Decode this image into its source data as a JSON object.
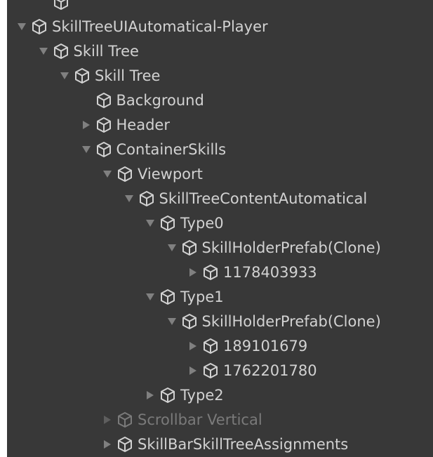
{
  "colors": {
    "panel_bg": "#383838",
    "text": "#d2d2d2",
    "text_disabled": "#7a7a7a",
    "arrow": "#808080",
    "arrow_disabled": "#5e5e5e",
    "icon": "#d2d2d2",
    "icon_disabled": "#7a7a7a"
  },
  "hierarchy": {
    "items": [
      {
        "label": "",
        "depth": 1,
        "arrow": "none",
        "icon": "gameobject-cube-icon",
        "disabled": false
      },
      {
        "label": "SkillTreeUIAutomatical-Player",
        "depth": 0,
        "arrow": "expanded",
        "icon": "gameobject-cube-icon",
        "disabled": false
      },
      {
        "label": "Skill Tree",
        "depth": 1,
        "arrow": "expanded",
        "icon": "gameobject-cube-icon",
        "disabled": false
      },
      {
        "label": "Skill Tree",
        "depth": 2,
        "arrow": "expanded",
        "icon": "gameobject-cube-icon",
        "disabled": false
      },
      {
        "label": "Background",
        "depth": 3,
        "arrow": "none",
        "icon": "gameobject-cube-icon",
        "disabled": false
      },
      {
        "label": "Header",
        "depth": 3,
        "arrow": "collapsed",
        "icon": "gameobject-cube-icon",
        "disabled": false
      },
      {
        "label": "ContainerSkills",
        "depth": 3,
        "arrow": "expanded",
        "icon": "gameobject-cube-icon",
        "disabled": false
      },
      {
        "label": "Viewport",
        "depth": 4,
        "arrow": "expanded",
        "icon": "gameobject-cube-icon",
        "disabled": false
      },
      {
        "label": "SkillTreeContentAutomatical",
        "depth": 5,
        "arrow": "expanded",
        "icon": "gameobject-cube-icon",
        "disabled": false
      },
      {
        "label": "Type0",
        "depth": 6,
        "arrow": "expanded",
        "icon": "gameobject-cube-icon",
        "disabled": false
      },
      {
        "label": "SkillHolderPrefab(Clone)",
        "depth": 7,
        "arrow": "expanded",
        "icon": "gameobject-cube-icon",
        "disabled": false
      },
      {
        "label": "1178403933",
        "depth": 8,
        "arrow": "collapsed",
        "icon": "gameobject-cube-icon",
        "disabled": false
      },
      {
        "label": "Type1",
        "depth": 6,
        "arrow": "expanded",
        "icon": "gameobject-cube-icon",
        "disabled": false
      },
      {
        "label": "SkillHolderPrefab(Clone)",
        "depth": 7,
        "arrow": "expanded",
        "icon": "gameobject-cube-icon",
        "disabled": false
      },
      {
        "label": "189101679",
        "depth": 8,
        "arrow": "collapsed",
        "icon": "gameobject-cube-icon",
        "disabled": false
      },
      {
        "label": "1762201780",
        "depth": 8,
        "arrow": "collapsed",
        "icon": "gameobject-cube-icon",
        "disabled": false
      },
      {
        "label": "Type2",
        "depth": 6,
        "arrow": "collapsed",
        "icon": "gameobject-cube-icon",
        "disabled": false
      },
      {
        "label": "Scrollbar Vertical",
        "depth": 4,
        "arrow": "collapsed",
        "icon": "gameobject-cube-icon",
        "disabled": true
      },
      {
        "label": "SkillBarSkillTreeAssignments",
        "depth": 4,
        "arrow": "collapsed",
        "icon": "gameobject-cube-icon",
        "disabled": false
      }
    ]
  }
}
